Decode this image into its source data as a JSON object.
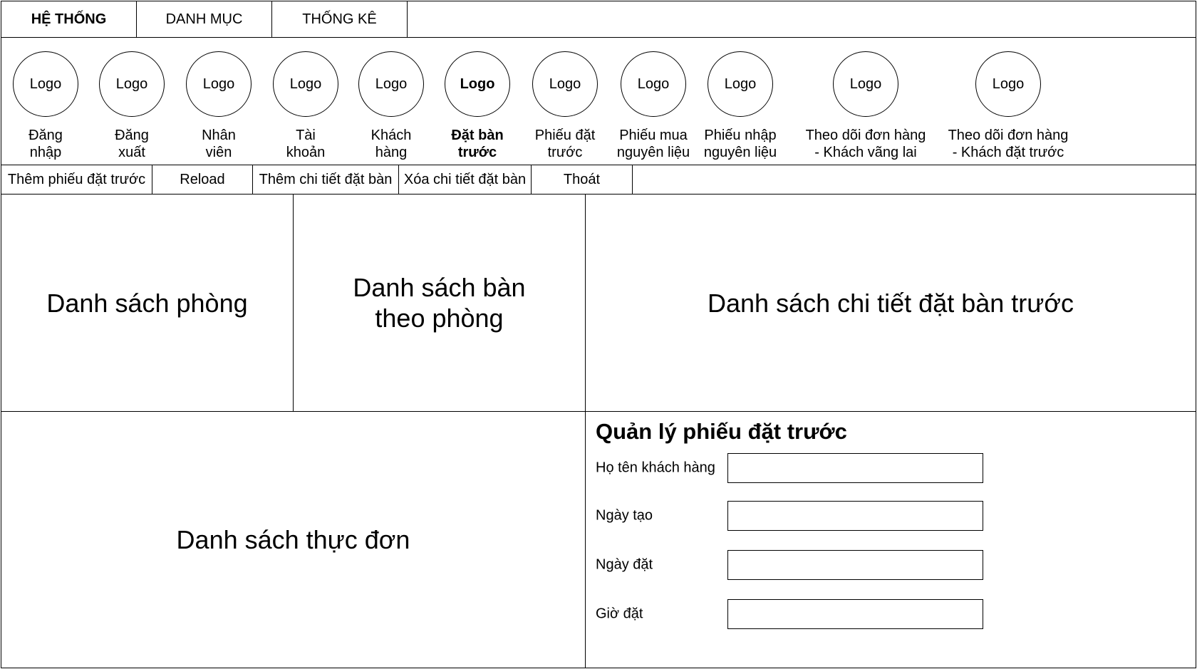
{
  "menu": {
    "tabs": [
      {
        "label": "HỆ THỐNG",
        "active": true
      },
      {
        "label": "DANH MỤC",
        "active": false
      },
      {
        "label": "THỐNG KÊ",
        "active": false
      }
    ]
  },
  "ribbon": {
    "items": [
      {
        "logo": "Logo",
        "label": "Đăng\nnhập"
      },
      {
        "logo": "Logo",
        "label": "Đăng\nxuất"
      },
      {
        "logo": "Logo",
        "label": "Nhân\nviên"
      },
      {
        "logo": "Logo",
        "label": "Tài\nkhoản"
      },
      {
        "logo": "Logo",
        "label": "Khách\nhàng"
      },
      {
        "logo": "Logo",
        "label": "Đặt bàn\ntrước",
        "active": true
      },
      {
        "logo": "Logo",
        "label": "Phiếu đặt\ntrước"
      },
      {
        "logo": "Logo",
        "label": "Phiếu mua\nnguyên liệu"
      },
      {
        "logo": "Logo",
        "label": "Phiếu nhập\nnguyên liệu"
      },
      {
        "logo": "Logo",
        "label": "Theo dõi đơn hàng\n- Khách vãng lai"
      },
      {
        "logo": "Logo",
        "label": "Theo dõi đơn hàng\n- Khách đặt trước"
      }
    ]
  },
  "toolbar": {
    "add_reservation": "Thêm phiếu đặt trước",
    "reload": "Reload",
    "add_detail": "Thêm chi tiết đặt bàn",
    "delete_detail": "Xóa chi tiết đặt bàn",
    "exit": "Thoát"
  },
  "panels": {
    "rooms": "Danh sách phòng",
    "tables": "Danh sách bàn\ntheo phòng",
    "details": "Danh sách chi tiết đặt bàn trước",
    "menu": "Danh sách thực đơn"
  },
  "form": {
    "title": "Quản lý phiếu đặt trước",
    "customer_name_label": "Họ tên khách hàng",
    "customer_name_value": "",
    "created_date_label": "Ngày tạo",
    "created_date_value": "",
    "booking_date_label": "Ngày đặt",
    "booking_date_value": "",
    "booking_time_label": "Giờ đặt",
    "booking_time_value": ""
  }
}
